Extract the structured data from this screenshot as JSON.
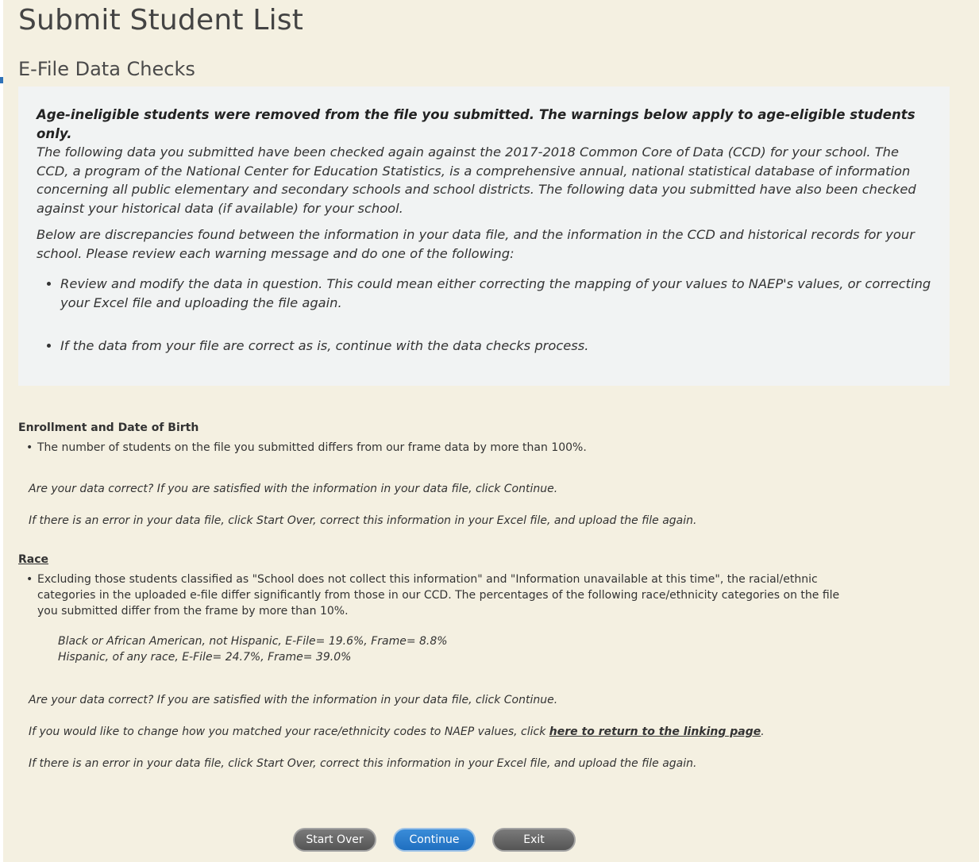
{
  "page": {
    "title": "Submit Student List",
    "subtitle": "E-File Data Checks"
  },
  "notice": {
    "strong": "Age-ineligible students were removed from the file you submitted. The warnings below apply to age-eligible students only.",
    "para1": "The following data you submitted have been checked again against the 2017-2018 Common Core of Data (CCD) for your school. The CCD, a program of the National Center for Education Statistics, is a comprehensive annual, national statistical database of information concerning all public elementary and secondary schools and school districts. The following data you submitted have also been checked against your historical data (if available) for your school.",
    "para2": "Below are discrepancies found between the information in your data file, and the information in the CCD and historical records for your school. Please review each warning message and do one of the following:",
    "items": [
      "Review and modify the data in question. This could mean either correcting the mapping of your values to NAEP's values, or correcting your Excel file and uploading the file again.",
      "If the data from your file are correct as is, continue with the data checks process."
    ]
  },
  "enrollment": {
    "title": "Enrollment and Date of Birth",
    "bullet": "The number of students on the file you submitted differs from our frame data by more than 100%.",
    "correct_line": "Are your data correct? If you are satisfied with the information in your data file, click Continue.",
    "error_line": "If there is an error in your data file, click Start Over, correct this information in your Excel file, and upload the file again."
  },
  "race": {
    "title": "Race",
    "bullet": "Excluding those students classified as \"School does not collect this information\" and \"Information unavailable at this time\", the racial/ethnic categories in the uploaded e-file differ significantly from those in our CCD. The percentages of the following race/ethnicity categories on the file you submitted differ from the frame by more than 10%.",
    "rows": [
      "Black or African American, not Hispanic, E-File= 19.6%, Frame= 8.8%",
      "Hispanic, of any race, E-File= 24.7%, Frame= 39.0%"
    ],
    "correct_line": "Are your data correct? If you are satisfied with the information in your data file, click Continue.",
    "linking_prefix": "If you would like to change how you matched your race/ethnicity codes to NAEP values, click ",
    "linking_link": "here to return to the linking page",
    "linking_suffix": ".",
    "error_line": "If there is an error in your data file, click Start Over, correct this information in your Excel file, and upload the file again."
  },
  "buttons": {
    "start_over": "Start Over",
    "continue": "Continue",
    "exit": "Exit"
  },
  "colors": {
    "background": "#f4f0e1",
    "notice_bg": "#f1f3f3",
    "primary_button": "#1f6fc0",
    "secondary_button": "#555555"
  }
}
